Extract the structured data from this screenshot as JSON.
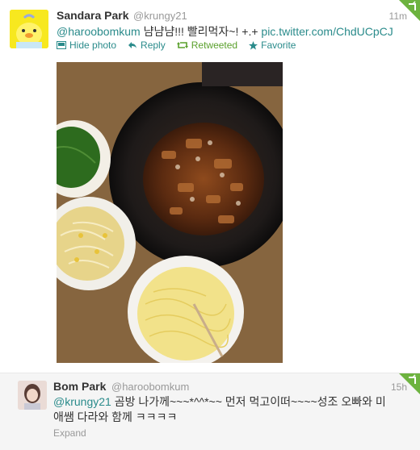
{
  "tweet1": {
    "name": "Sandara Park",
    "handle": "@krungy21",
    "time": "11m",
    "mention": "@haroobomkum",
    "text": " 냠냠냠!!! 빨리먹자~! +.+ ",
    "link": "pic.twitter.com/ChdUCpCJ",
    "actions": {
      "hide_photo": "Hide photo",
      "reply": "Reply",
      "retweeted": "Retweeted",
      "favorite": "Favorite"
    }
  },
  "tweet2": {
    "name": "Bom Park",
    "handle": "@haroobomkum",
    "time": "15h",
    "mention": "@krungy21",
    "text_line1": " 곰방 나가께~~~*^^*~~ 먼저 먹고이떠~~~~성조 오빠와 미",
    "text_line2": "애쌤 다라와 함께 ㅋㅋㅋㅋ",
    "expand": "Expand"
  },
  "colors": {
    "link": "#2a8b8b",
    "retweet": "#5aa02c",
    "corner": "#5aa02c"
  }
}
